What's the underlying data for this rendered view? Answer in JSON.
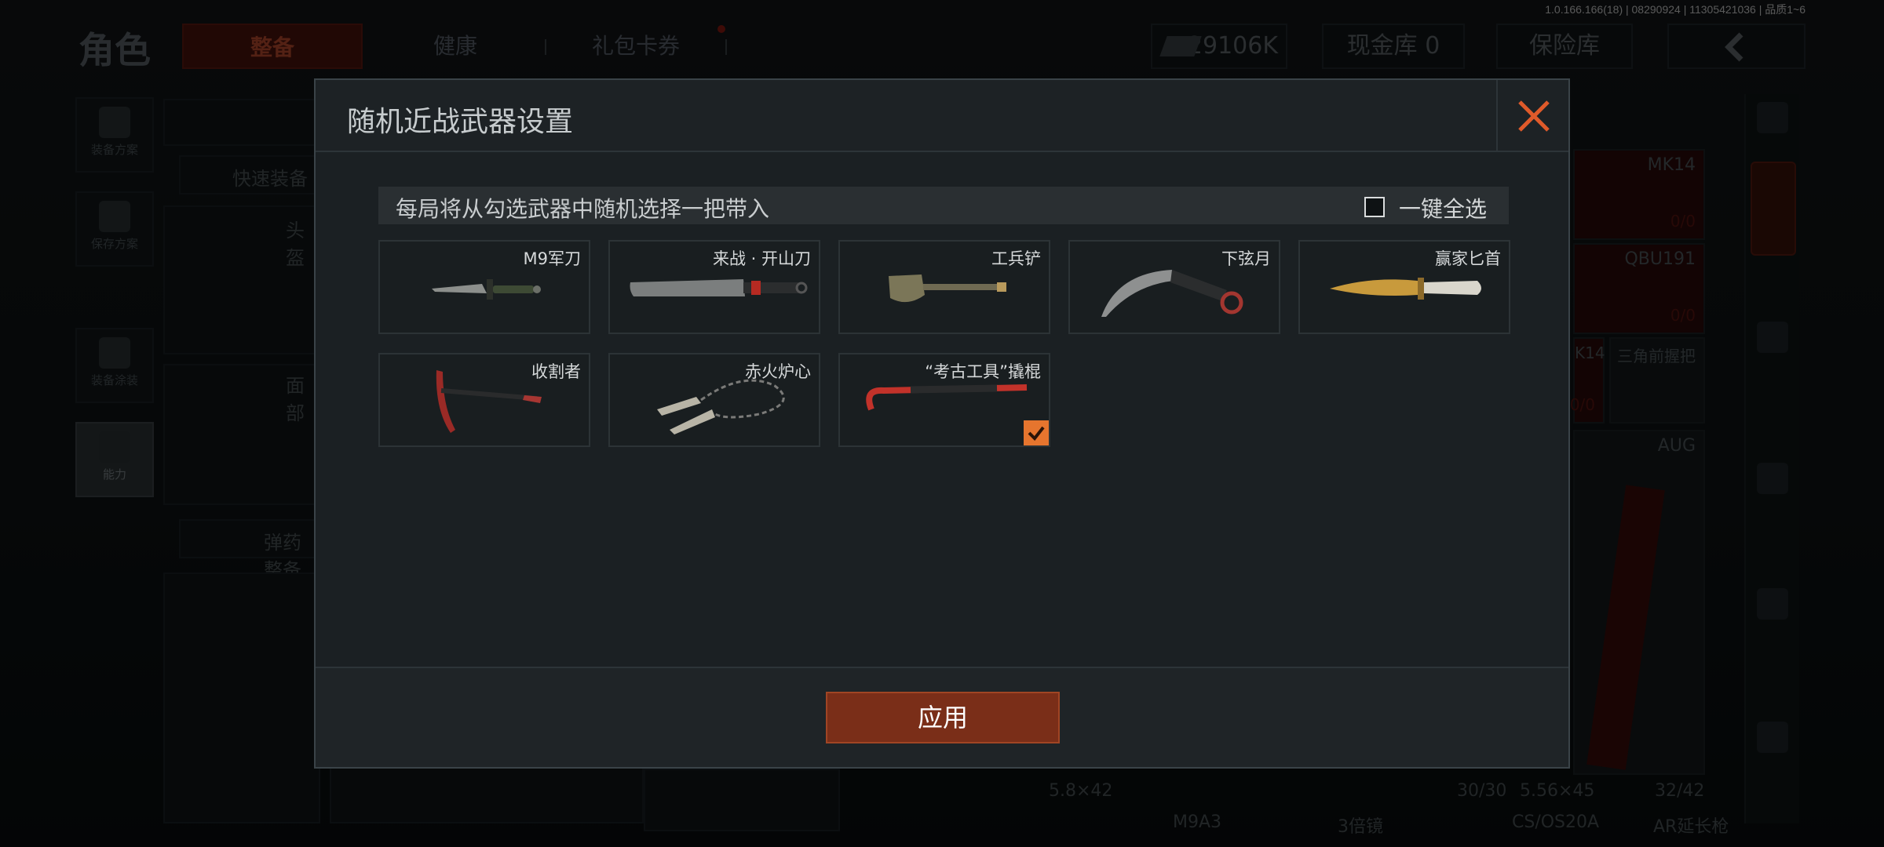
{
  "version_text": "1.0.166.166(18) | 08290924 | 11305421036 | 品质1~6",
  "nav": {
    "title": "角色",
    "tabs": [
      "整备",
      "健康",
      "礼包卡券"
    ],
    "currency": "29106K",
    "cash_vault": "现金库 0",
    "insurance": "保险库"
  },
  "left_rail": [
    {
      "label": "装备方案",
      "icon": "vest-icon"
    },
    {
      "label": "保存方案",
      "icon": "download-icon"
    },
    {
      "label": "装备涂装",
      "icon": "helmet-icon"
    },
    {
      "label": "能力",
      "icon": "lightning-hex-icon"
    }
  ],
  "background": {
    "quick_equip": "快速装备",
    "head": "头盔",
    "face": "面部",
    "ammo_equip": "弹药整备",
    "weapons": [
      {
        "name": "MK14",
        "ammo": "0/0"
      },
      {
        "name": "QBU191",
        "ammo": "0/0"
      },
      {
        "name": "AUG"
      }
    ],
    "attachments": [
      "K14",
      "三角前握把"
    ],
    "attach_ammo": "0/0",
    "bottom_labels": [
      "5.8×42",
      "30/30",
      "5.56×45",
      "32/42",
      "M9A3",
      "3倍镜",
      "CS/OS20A",
      "AR延长枪"
    ]
  },
  "modal": {
    "title": "随机近战武器设置",
    "info": "每局将从勾选武器中随机选择一把带入",
    "select_all": "一键全选",
    "select_all_checked": false,
    "weapons": [
      {
        "name": "M9军刀",
        "icon": "bayonet-icon",
        "checked": false
      },
      {
        "name": "来战 · 开山刀",
        "icon": "machete-icon",
        "checked": false
      },
      {
        "name": "工兵铲",
        "icon": "shovel-icon",
        "checked": false
      },
      {
        "name": "下弦月",
        "icon": "karambit-icon",
        "checked": false
      },
      {
        "name": "赢家匕首",
        "icon": "dagger-icon",
        "checked": false
      },
      {
        "name": "收割者",
        "icon": "pickaxe-icon",
        "checked": false
      },
      {
        "name": "赤火炉心",
        "icon": "rope-dart-icon",
        "checked": false
      },
      {
        "name": "“考古工具”撬棍",
        "icon": "crowbar-icon",
        "checked": true
      }
    ],
    "apply_label": "应用",
    "colors": {
      "accent": "#e6752e",
      "apply_bg": "#7a2e18",
      "close": "#e05a2a"
    }
  }
}
